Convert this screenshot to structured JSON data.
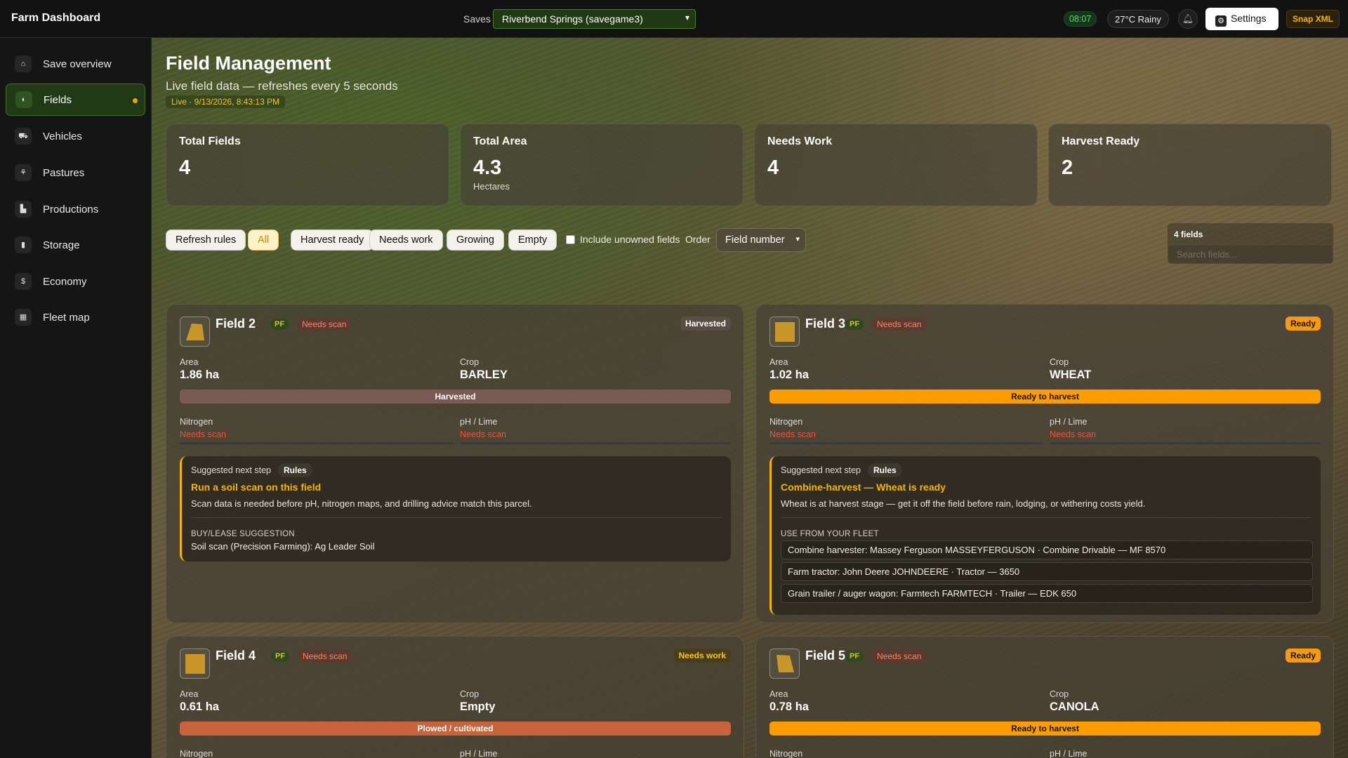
{
  "app": {
    "brand": "Farm Dashboard",
    "saves_label": "Saves",
    "save_selected": "Riverbend Springs (savegame3)",
    "time": "08:07",
    "weather": "27°C Rainy",
    "settings_label": "Settings",
    "snap_label": "Snap XML"
  },
  "sidebar": {
    "items": [
      {
        "label": "Save overview",
        "icon": "house-icon"
      },
      {
        "label": "Fields",
        "icon": "field-icon",
        "active": true
      },
      {
        "label": "Vehicles",
        "icon": "tractor-icon"
      },
      {
        "label": "Pastures",
        "icon": "pasture-icon"
      },
      {
        "label": "Productions",
        "icon": "factory-icon"
      },
      {
        "label": "Storage",
        "icon": "silo-icon"
      },
      {
        "label": "Economy",
        "icon": "coins-icon"
      },
      {
        "label": "Fleet map",
        "icon": "map-icon"
      }
    ]
  },
  "header": {
    "title": "Field Management",
    "subtitle": "Live field data — refreshes every 5 seconds",
    "live": "Live · 9/13/2026, 8:43:13 PM"
  },
  "stats": [
    {
      "label": "Total Fields",
      "value": "4",
      "unit": ""
    },
    {
      "label": "Total Area",
      "value": "4.3",
      "unit": "Hectares"
    },
    {
      "label": "Needs Work",
      "value": "4",
      "unit": ""
    },
    {
      "label": "Harvest Ready",
      "value": "2",
      "unit": ""
    }
  ],
  "filters": {
    "refresh": "Refresh rules",
    "all": "All",
    "harvest_ready": "Harvest ready",
    "needs_work": "Needs work",
    "growing": "Growing",
    "empty": "Empty",
    "include_unowned": "Include unowned fields",
    "order_label": "Order",
    "order_value": "Field number",
    "count": "4 fields",
    "search_placeholder": "Search fields..."
  },
  "fields": [
    {
      "name": "Field 2",
      "pf": "PF",
      "scan": "Needs scan",
      "status": "Harvested",
      "area_label": "Area",
      "area": "1.86 ha",
      "crop_label": "Crop",
      "crop": "BARLEY",
      "bar": "Harvested",
      "nitrogen_label": "Nitrogen",
      "nitrogen": "Needs scan",
      "ph_label": "pH / Lime",
      "ph": "Needs scan",
      "advice_label": "Suggested next step",
      "rules": "Rules",
      "advice_title": "Run a soil scan on this field",
      "advice_body": "Scan data is needed before pH, nitrogen maps, and drilling advice match this parcel.",
      "advice_sub": "BUY/LEASE SUGGESTION",
      "advice_sugg": "Soil scan (Precision Farming): Ag Leader Soil"
    },
    {
      "name": "Field 3",
      "pf": "PF",
      "scan": "Needs scan",
      "status": "Ready",
      "area_label": "Area",
      "area": "1.02 ha",
      "crop_label": "Crop",
      "crop": "WHEAT",
      "bar": "Ready to harvest",
      "nitrogen_label": "Nitrogen",
      "nitrogen": "Needs scan",
      "ph_label": "pH / Lime",
      "ph": "Needs scan",
      "advice_label": "Suggested next step",
      "rules": "Rules",
      "advice_title": "Combine-harvest — Wheat is ready",
      "advice_body": "Wheat is at harvest stage — get it off the field before rain, lodging, or withering costs yield.",
      "advice_sub": "USE FROM YOUR FLEET",
      "fleet": [
        "Combine harvester: Massey Ferguson MASSEYFERGUSON · Combine Drivable — MF 8570",
        "Farm tractor: John Deere JOHNDEERE · Tractor — 3650",
        "Grain trailer / auger wagon: Farmtech FARMTECH · Trailer — EDK 650"
      ]
    },
    {
      "name": "Field 4",
      "pf": "PF",
      "scan": "Needs scan",
      "status": "Needs work",
      "area_label": "Area",
      "area": "0.61 ha",
      "crop_label": "Crop",
      "crop": "Empty",
      "bar": "Plowed / cultivated",
      "nitrogen_label": "Nitrogen",
      "ph_label": "pH / Lime"
    },
    {
      "name": "Field 5",
      "pf": "PF",
      "scan": "Needs scan",
      "status": "Ready",
      "area_label": "Area",
      "area": "0.78 ha",
      "crop_label": "Crop",
      "crop": "CANOLA",
      "bar": "Ready to harvest",
      "nitrogen_label": "Nitrogen",
      "ph_label": "pH / Lime"
    }
  ]
}
